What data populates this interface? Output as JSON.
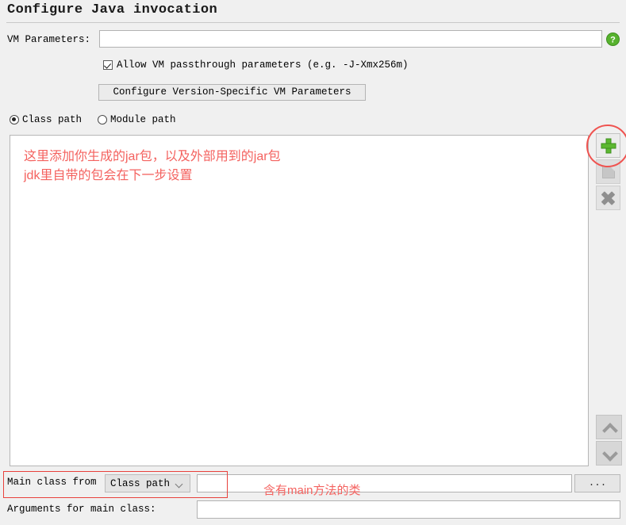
{
  "dialog": {
    "title": "Configure Java invocation"
  },
  "vm_parameters": {
    "label": "VM Parameters:",
    "value": "",
    "placeholder": "",
    "help_icon": "help-icon"
  },
  "passthrough": {
    "label": "Allow VM passthrough parameters (e.g. -J-Xmx256m)",
    "checked": true
  },
  "version_params": {
    "button_label": "Configure Version-Specific VM Parameters"
  },
  "path_mode": {
    "options": [
      {
        "label": "Class path",
        "selected": true
      },
      {
        "label": "Module path",
        "selected": false
      }
    ]
  },
  "classpath_list": {
    "entries": [],
    "toolbar": {
      "add": "add-icon",
      "edit": "edit-icon",
      "remove": "remove-icon",
      "move_up": "chevron-up-icon",
      "move_down": "chevron-down-icon"
    }
  },
  "annotations": {
    "list_note_line1": "这里添加你生成的jar包，以及外部用到的jar包",
    "list_note_line2": "jdk里自带的包会在下一步设置",
    "main_class_note": "含有main方法的类",
    "highlight_color": "#ef5350"
  },
  "main_class": {
    "label": "Main class from",
    "source_value": "Class path",
    "source_options": [
      "Class path",
      "Module path"
    ],
    "value": "",
    "browse_label": "..."
  },
  "arguments": {
    "label": "Arguments for main class:",
    "value": "",
    "placeholder": ""
  },
  "colors": {
    "background": "#f0f0f0",
    "field_background": "#ffffff",
    "accent_green": "#5cb831",
    "annotation_red": "#f4625f"
  }
}
